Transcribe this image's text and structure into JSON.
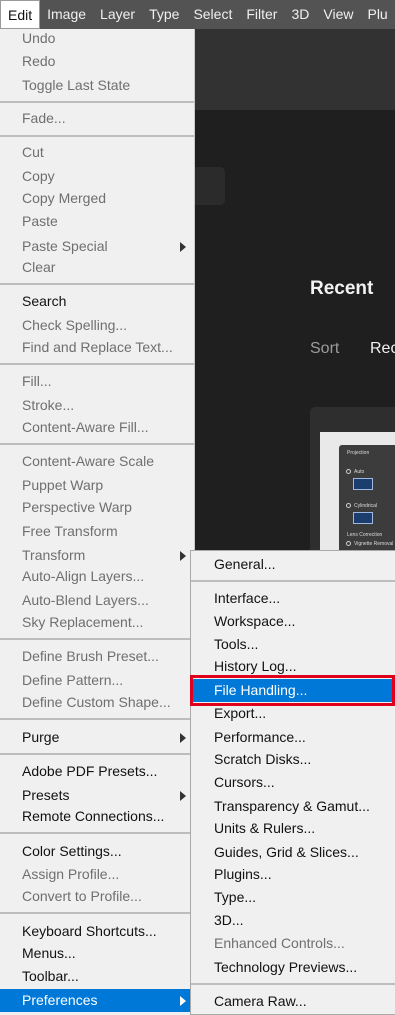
{
  "menubar": {
    "items": [
      "Edit",
      "Image",
      "Layer",
      "Type",
      "Select",
      "Filter",
      "3D",
      "View",
      "Plu"
    ]
  },
  "background": {
    "recent_heading": "Recent",
    "sort_label": "Sort",
    "sort_value": "Rec",
    "thumbnail_panel": {
      "projection": "Projection",
      "auto": "Auto",
      "cylindrical": "Cylindrical",
      "lens_correction": "Lens Correction",
      "vignette_removal": "Vignette Removal"
    }
  },
  "edit_menu": {
    "undo": "Undo",
    "redo": "Redo",
    "toggle_last_state": "Toggle Last State",
    "fade": "Fade...",
    "cut": "Cut",
    "copy": "Copy",
    "copy_merged": "Copy Merged",
    "paste": "Paste",
    "paste_special": "Paste Special",
    "clear": "Clear",
    "search": "Search",
    "check_spelling": "Check Spelling...",
    "find_replace": "Find and Replace Text...",
    "fill": "Fill...",
    "stroke": "Stroke...",
    "content_aware_fill": "Content-Aware Fill...",
    "content_aware_scale": "Content-Aware Scale",
    "puppet_warp": "Puppet Warp",
    "perspective_warp": "Perspective Warp",
    "free_transform": "Free Transform",
    "transform": "Transform",
    "auto_align": "Auto-Align Layers...",
    "auto_blend": "Auto-Blend Layers...",
    "sky_replacement": "Sky Replacement...",
    "define_brush": "Define Brush Preset...",
    "define_pattern": "Define Pattern...",
    "define_shape": "Define Custom Shape...",
    "purge": "Purge",
    "pdf_presets": "Adobe PDF Presets...",
    "presets": "Presets",
    "remote_connections": "Remote Connections...",
    "color_settings": "Color Settings...",
    "assign_profile": "Assign Profile...",
    "convert_profile": "Convert to Profile...",
    "keyboard_shortcuts": "Keyboard Shortcuts...",
    "menus": "Menus...",
    "toolbar": "Toolbar...",
    "preferences": "Preferences"
  },
  "preferences_menu": {
    "general": "General...",
    "interface": "Interface...",
    "workspace": "Workspace...",
    "tools": "Tools...",
    "history_log": "History Log...",
    "file_handling": "File Handling...",
    "export": "Export...",
    "performance": "Performance...",
    "scratch_disks": "Scratch Disks...",
    "cursors": "Cursors...",
    "transparency": "Transparency & Gamut...",
    "units_rulers": "Units & Rulers...",
    "guides_grid": "Guides, Grid & Slices...",
    "plugins": "Plugins...",
    "type": "Type...",
    "three_d": "3D...",
    "enhanced_controls": "Enhanced Controls...",
    "technology_previews": "Technology Previews...",
    "camera_raw": "Camera Raw..."
  },
  "colors": {
    "highlight": "#0078d7",
    "callout": "#e0001b",
    "menubar": "#535353"
  }
}
